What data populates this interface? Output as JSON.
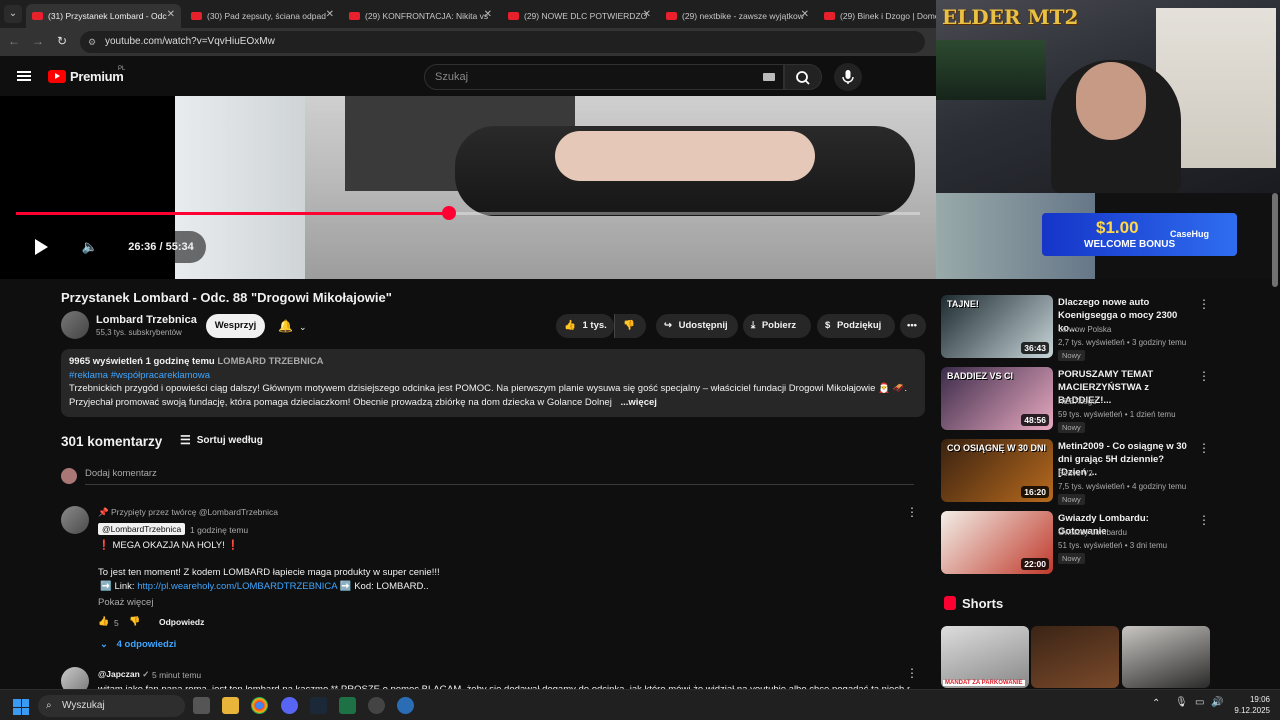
{
  "browser": {
    "tabs": [
      {
        "title": "(31) Przystanek Lombard - Odc",
        "active": true
      },
      {
        "title": "(30) Pad zepsuty, ściana odpad",
        "active": false
      },
      {
        "title": "(29) KONFRONTACJA: Nikita vs",
        "active": false
      },
      {
        "title": "(29) NOWE DLC POTWIERDZO",
        "active": false
      },
      {
        "title": "(29) nextbike - zawsze wyjątkow",
        "active": false
      },
      {
        "title": "(29) Binek i Dzogo | Domek",
        "active": false
      }
    ],
    "url": "youtube.com/watch?v=VqvHiuEOxMw"
  },
  "youtube": {
    "logo_text": "Premium",
    "logo_region": "PL",
    "search_placeholder": "Szukaj"
  },
  "player": {
    "time_current": "26:36",
    "time_total": "55:34",
    "time_display": "26:36 / 55:34",
    "progress_fraction": 0.4788
  },
  "video": {
    "title": "Przystanek Lombard - Odc. 88 \"Drogowi Mikołajowie\"",
    "channel_name": "Lombard Trzebnica",
    "subscribers": "55,3 tys. subskrybentów",
    "support_label": "Wesprzyj",
    "likes": "1 tys.",
    "share_label": "Udostępnij",
    "download_label": "Pobierz",
    "thanks_label": "Podziękuj"
  },
  "description": {
    "views": "9965 wyświetleń",
    "time": "1 godzinę temu",
    "channel_tag": "LOMBARD TRZEBNICA",
    "hashtags": "#reklama #współpracareklamowa",
    "line1": "Trzebnickich przygód i opowieści ciąg dalszy! Głównym motywem dzisiejszego odcinka jest POMOC. Na pierwszym planie wysuwa się gość specjalny – właściciel fundacji Drogowi Mikołajowie 🎅 🛷.",
    "line2": "Przyjechał promować swoją fundację, która pomaga dzieciaczkom! Obecnie prowadzą zbiórkę na dom dziecka w Golance Dolnej",
    "more": "...więcej"
  },
  "comments": {
    "count": "301 komentarzy",
    "sort_label": "Sortuj według",
    "add_placeholder": "Dodaj komentarz",
    "items": [
      {
        "pinned": "Przypięty przez twórcę @LombardTrzebnica",
        "author": "@LombardTrzebnica",
        "time": "1 godzinę temu",
        "line1": "❗ MEGA OKAZJA NA HOLY! ❗",
        "line2": "To jest ten moment! Z kodem LOMBARD łapiecie maga produkty w super cenie!!!",
        "link_prefix": "➡️ Link: ",
        "link": "http://pl.weareholy.com/LOMBARDTRZEBNICA",
        "code": " ➡️ Kod: LOMBARD..",
        "show_more": "Pokaż więcej",
        "likes": "5",
        "reply_label": "Odpowiedz",
        "replies": "4 odpowiedzi"
      },
      {
        "author": "@Japczan",
        "time": "5 minut temu",
        "text": "witam jako fan pana roma, jest ten lombard na kaczmo ** PROSZE o pomoc BLAGAM, żeby się dodawał dogamy do odcinka, jak które mówi że widział na youtubie albo chce pogadać ta niech na koleżce"
      }
    ]
  },
  "stream": {
    "overlay_text": "ELDER MT2",
    "ad_amount": "$1.00",
    "ad_text": "WELCOME BONUS",
    "ad_brand": "CaseHug"
  },
  "recommended": [
    {
      "title": "Dlaczego nowe auto Koenigsegga o mocy 2300 ko...",
      "channel": "carwow Polska",
      "meta": "2,7 tys. wyświetleń • 3 godziny temu",
      "badge": "Nowy",
      "duration": "36:43",
      "thumb_text": "TAJNE!",
      "colors": [
        "#1d2a30",
        "#c8d6da"
      ]
    },
    {
      "title": "PORUSZAMY TEMAT MACIERZYŃSTWA z BADDIEZ!...",
      "channel": "NEEXcsgo",
      "meta": "59 tys. wyświetleń • 1 dzień temu",
      "badge": "Nowy",
      "duration": "48:56",
      "thumb_text": "BADDIEZ VS CI",
      "colors": [
        "#3b2b4a",
        "#e9a9c0"
      ]
    },
    {
      "title": "Metin2009 - Co osiągnę w 30 dni grając 5H dziennie? [Dzień ...",
      "channel": "Beave V2",
      "meta": "7,5 tys. wyświetleń • 4 godziny temu",
      "badge": "Nowy",
      "duration": "16:20",
      "thumb_text": "CO OSIĄGNĘ W 30 DNI",
      "colors": [
        "#3a2210",
        "#b76a1e"
      ]
    },
    {
      "title": "Gwiazdy Lombardu: Gotowanie",
      "channel": "Gwiazdy Lombardu",
      "meta": "51 tys. wyświetleń • 3 dni temu",
      "badge": "Nowy",
      "duration": "22:00",
      "thumb_text": "",
      "colors": [
        "#f2efe8",
        "#c0392b"
      ]
    }
  ],
  "shorts": {
    "label": "Shorts",
    "items": [
      {
        "text": "MANDAT ZA PARKOWANIE",
        "colors": [
          "#ddd",
          "#888"
        ]
      },
      {
        "text": "",
        "colors": [
          "#3b2416",
          "#7a4a2a"
        ]
      },
      {
        "text": "",
        "colors": [
          "#c9c6c2",
          "#2a2a2a"
        ]
      }
    ]
  },
  "taskbar": {
    "search_label": "Wyszukaj",
    "time": "19:06",
    "date": "9.12.2025"
  }
}
